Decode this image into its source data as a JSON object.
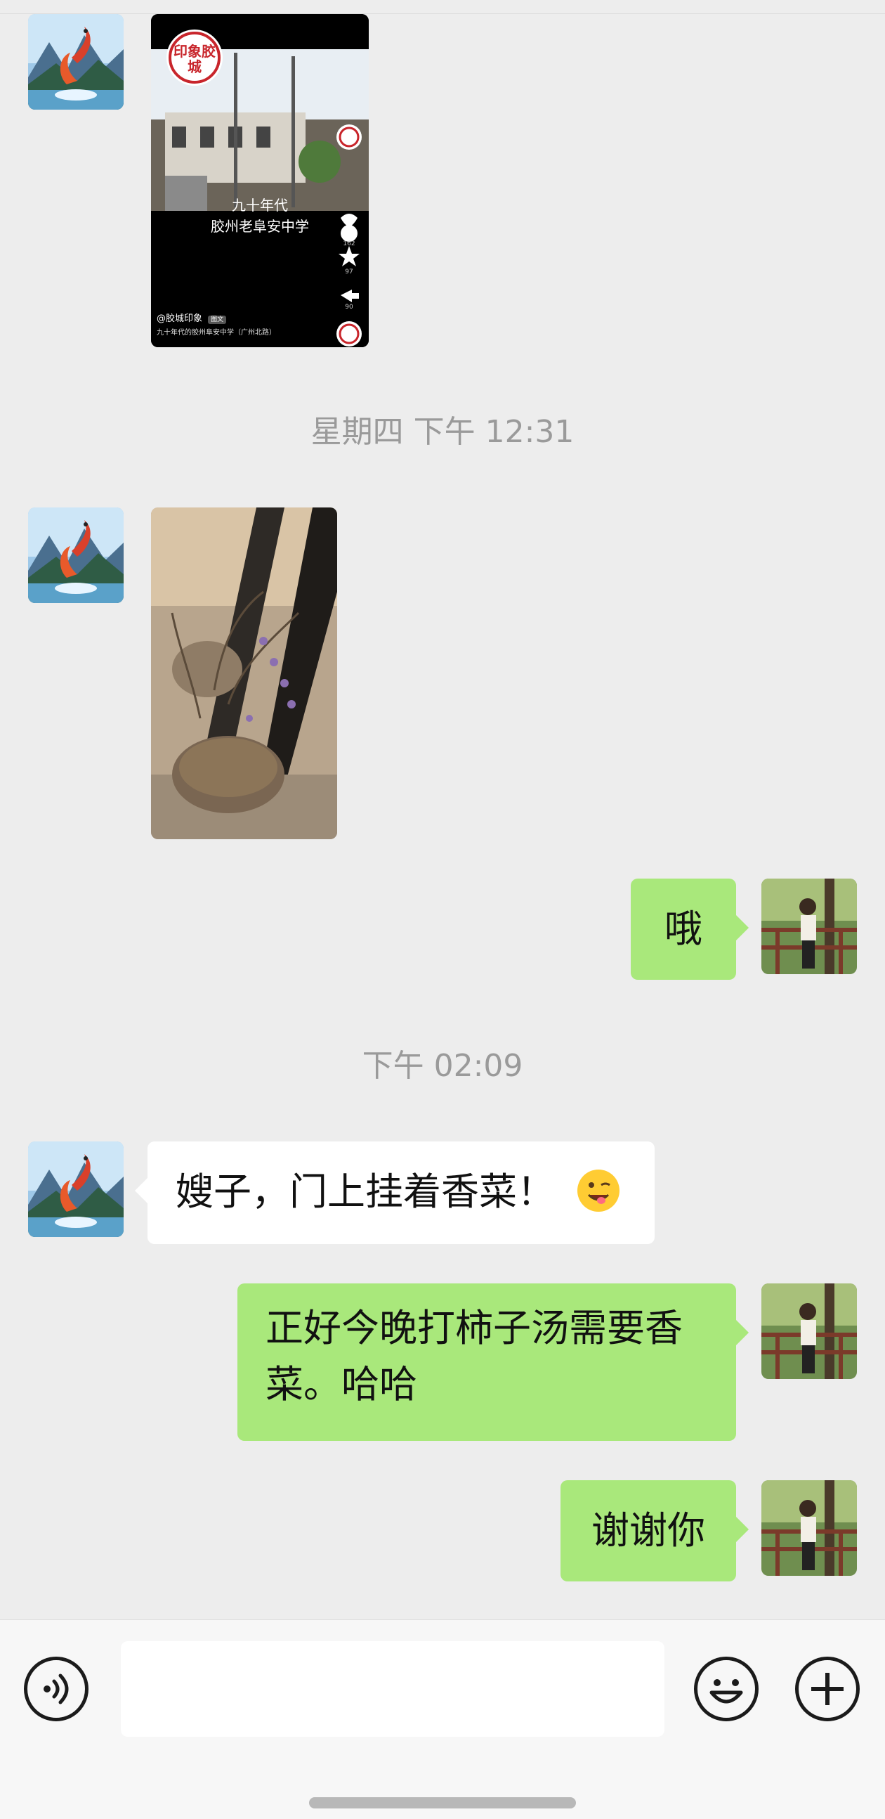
{
  "timestamps": [
    "星期四 下午 12:31",
    "下午 02:09"
  ],
  "shared_card": {
    "badge_text": "印象胶城",
    "title_line1": "九十年代",
    "title_line2": "胶州老阜安中学",
    "comment_count": "162",
    "star_count": "97",
    "share_count": "90",
    "author": "@胶城印象",
    "tag": "图文",
    "caption": "九十年代的胶州阜安中学（广州北路）"
  },
  "messages": {
    "m1_text": "哦",
    "m2_text": "嫂子，门上挂着香菜！",
    "m3_line1": "正好今晚打柿子汤需要香",
    "m3_line2": "菜。哈哈",
    "m4_text": "谢谢你"
  },
  "icons": {
    "voice": "voice-icon",
    "emoji": "emoji-icon",
    "plus": "plus-icon",
    "wink": "wink-emoji-icon"
  },
  "colors": {
    "background": "#ededed",
    "sent_bubble": "#a9e87b",
    "received_bubble": "#ffffff",
    "timestamp": "#9a9a9a"
  }
}
